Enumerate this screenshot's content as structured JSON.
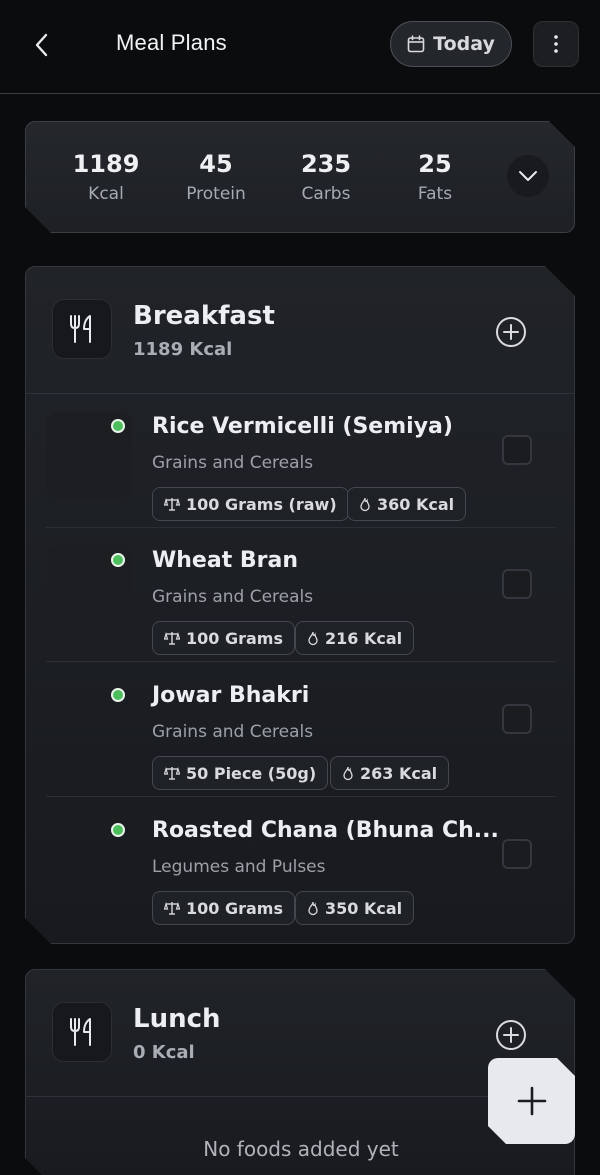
{
  "header": {
    "title": "Meal Plans",
    "today_label": "Today"
  },
  "summary": {
    "macros": [
      {
        "value": "1189",
        "label": "Kcal"
      },
      {
        "value": "45",
        "label": "Protein"
      },
      {
        "value": "235",
        "label": "Carbs"
      },
      {
        "value": "25",
        "label": "Fats"
      }
    ]
  },
  "meals": [
    {
      "name": "Breakfast",
      "kcal": "1189 Kcal",
      "foods": [
        {
          "name": "Rice Vermicelli (Semiya)",
          "category": "Grains and Cereals",
          "quantity": "100 Grams (raw)",
          "calories": "360 Kcal"
        },
        {
          "name": "Wheat Bran",
          "category": "Grains and Cereals",
          "quantity": "100 Grams",
          "calories": "216 Kcal"
        },
        {
          "name": "Jowar Bhakri",
          "category": "Grains and Cereals",
          "quantity": "50 Piece (50g)",
          "calories": "263 Kcal"
        },
        {
          "name": "Roasted Chana (Bhuna Ch...",
          "category": "Legumes and Pulses",
          "quantity": "100 Grams",
          "calories": "350 Kcal"
        }
      ]
    },
    {
      "name": "Lunch",
      "kcal": "0 Kcal",
      "empty_message": "No foods added yet"
    }
  ],
  "colors": {
    "background": "#0b0c0e",
    "card": "#1d2024",
    "status_dot": "#4cbf5c",
    "fab": "#e8e9ec"
  },
  "icons": {
    "back": "chevron-left-icon",
    "today": "calendar-icon",
    "more": "more-vertical-icon",
    "expand": "chevron-down-icon",
    "meal": "fork-knife-icon",
    "add": "plus-circle-icon",
    "quantity": "scale-icon",
    "calories": "flame-icon",
    "fab": "plus-icon"
  }
}
